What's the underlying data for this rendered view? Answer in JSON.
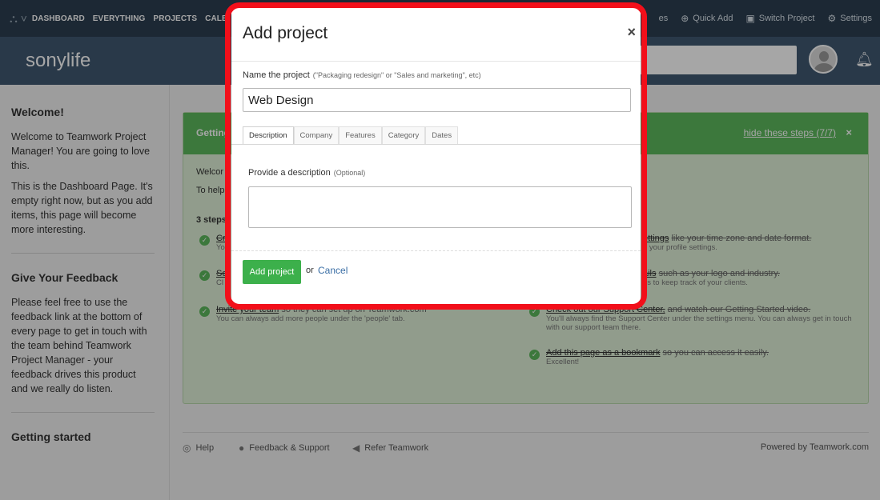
{
  "topnav": {
    "items": [
      "DASHBOARD",
      "EVERYTHING",
      "PROJECTS",
      "CALE"
    ],
    "right": [
      "es",
      "Quick Add",
      "Switch Project",
      "Settings"
    ]
  },
  "header": {
    "brand": "sonylife"
  },
  "sidebar": {
    "welcome_title": "Welcome!",
    "welcome_p1": "Welcome to Teamwork Project Manager! You are going to love this.",
    "welcome_p2": "This is the Dashboard Page. It's empty right now, but as you add items, this page will become more interesting.",
    "feedback_title": "Give Your Feedback",
    "feedback_p": "Please feel free to use the feedback link at the bottom of every page to get in touch with the team behind Teamwork Project Manager - your feedback drives this product and we really do listen.",
    "started_title": "Getting started"
  },
  "panel": {
    "title": "Getting",
    "hide_link": "hide these steps (7/7)",
    "close": "×",
    "welcome": "Welcor",
    "to_help": "To help",
    "steps_label": "3 steps",
    "left_steps": [
      {
        "link": "Cr",
        "rest": "",
        "sub": "Yo"
      },
      {
        "link": "Se",
        "rest": "",
        "sub": "Cl"
      },
      {
        "link": "Invite your team",
        "rest": "so they can set up on Teamwork.com",
        "sub": "You can always add more people under the 'people' tab."
      }
    ],
    "right_steps": [
      {
        "link": "ettings",
        "rest": "like your time zone and date format.",
        "sub": "n your profile settings."
      },
      {
        "link": "ails",
        "rest": "such as your logo and industry.",
        "sub": "es to keep track of your clients."
      },
      {
        "link": "Check out our Support Center,",
        "rest": "and watch our Getting Started video.",
        "sub": "You'll always find the Support Center under the settings menu. You can always get in touch with our support team there."
      },
      {
        "link": "Add this page as a bookmark",
        "rest": "so you can access it easily.",
        "sub": "Excellent!"
      }
    ]
  },
  "footer": {
    "help": "Help",
    "feedback": "Feedback & Support",
    "refer": "Refer Teamwork",
    "powered": "Powered by",
    "powered_brand": "Teamwork.com"
  },
  "modal": {
    "title": "Add project",
    "close": "×",
    "name_label": "Name the project",
    "name_hint": "(\"Packaging redesign\" or \"Sales and marketing\", etc)",
    "name_value": "Web Design",
    "tabs": [
      "Description",
      "Company",
      "Features",
      "Category",
      "Dates"
    ],
    "desc_label": "Provide a description",
    "desc_hint": "(Optional)",
    "add_button": "Add project",
    "or": "or",
    "cancel": "Cancel"
  },
  "colors": {
    "nav_bg": "#2b3e50",
    "header_bg": "#3f5871",
    "panel_green": "#5cb85c",
    "panel_bg": "#dff0d8",
    "add_button": "#3cb04b",
    "highlight": "#f20f1a"
  }
}
